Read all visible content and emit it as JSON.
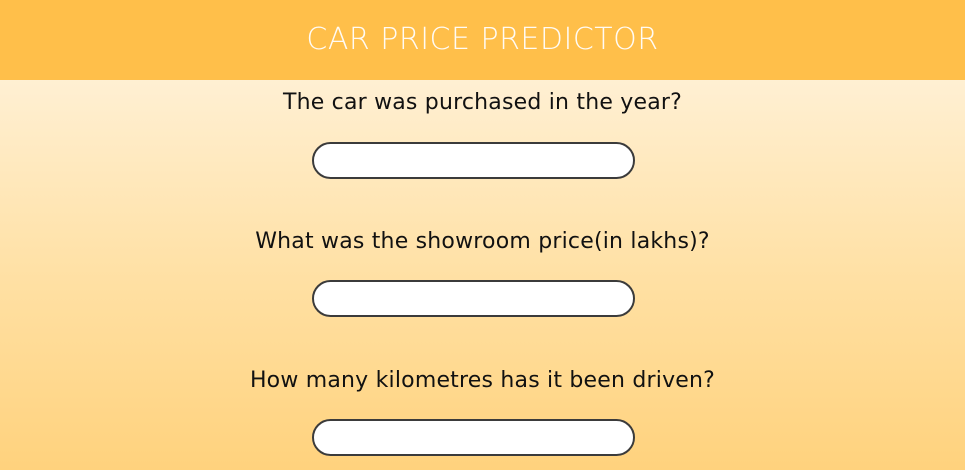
{
  "header": {
    "title": "CAR PRICE PREDICTOR"
  },
  "form": {
    "questions": [
      {
        "label": "The car was purchased in the year?",
        "value": "",
        "placeholder": ""
      },
      {
        "label": "What was the showroom price(in lakhs)?",
        "value": "",
        "placeholder": ""
      },
      {
        "label": "How many kilometres has it been driven?",
        "value": "",
        "placeholder": ""
      }
    ]
  },
  "colors": {
    "header_bg": "#ffbf4a",
    "header_text": "#ffffff",
    "page_gradient_top": "#fff6e6",
    "page_gradient_bottom": "#ffd27d",
    "input_border": "#3b3b3b"
  }
}
